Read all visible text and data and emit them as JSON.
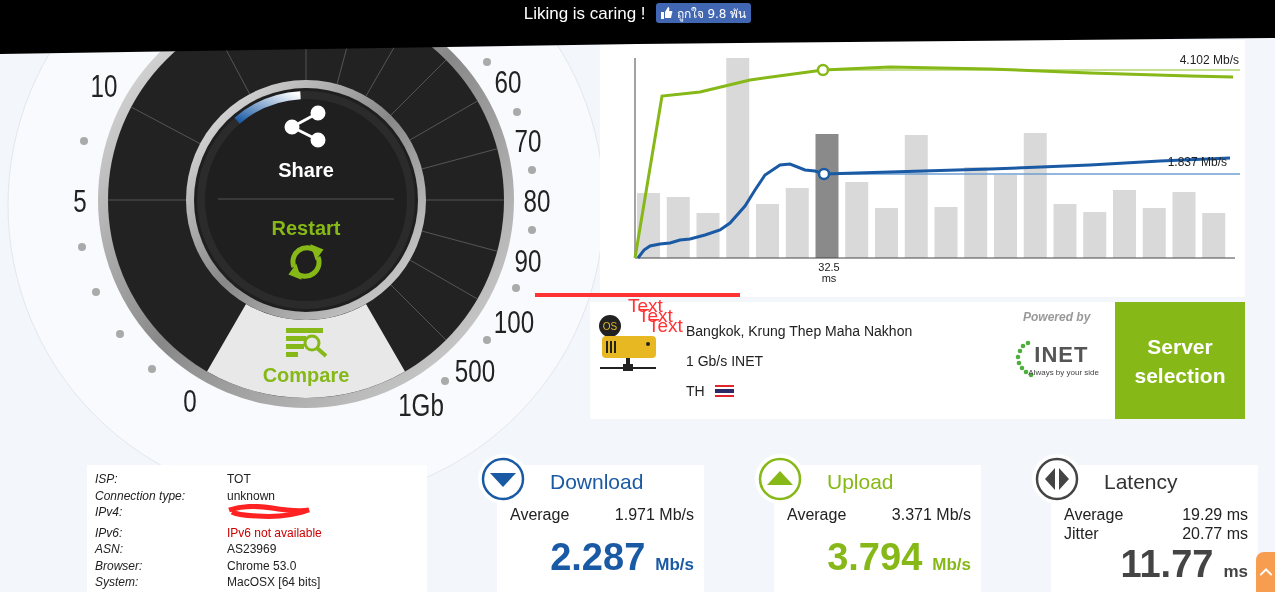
{
  "banner": {
    "text": "Liking is caring !",
    "like_button": "ถูกใจ 9.8 พัน"
  },
  "gauge": {
    "scale_labels": [
      "0",
      "5",
      "10",
      "60",
      "70",
      "80",
      "90",
      "100",
      "500",
      "1Gb"
    ],
    "share": "Share",
    "restart": "Restart",
    "compare": "Compare"
  },
  "chart": {
    "upload_label": "4.102 Mb/s",
    "download_label": "1.837 Mb/s",
    "marker_value": "32.5",
    "marker_unit": "ms"
  },
  "markup": {
    "texts": [
      "Text",
      "Text",
      "Text"
    ]
  },
  "server": {
    "badge": "OS",
    "location": "Bangkok, Krung Thep Maha Nakhon",
    "provider": "1 Gb/s INET",
    "country": "TH",
    "powered_by": "Powered by",
    "logo_text": "INET",
    "logo_tagline": "Always by your side",
    "button": "Server selection"
  },
  "connection_info": [
    {
      "label": "ISP:",
      "value": "TOT",
      "kind": "normal"
    },
    {
      "label": "Connection type:",
      "value": "unknown",
      "kind": "normal"
    },
    {
      "label": "IPv4:",
      "kind": "redacted"
    },
    {
      "label": "IPv6:",
      "value": "IPv6 not available",
      "kind": "error"
    },
    {
      "label": "ASN:",
      "value": "AS23969",
      "kind": "normal"
    },
    {
      "label": "Browser:",
      "value": "Chrome 53.0",
      "kind": "normal"
    },
    {
      "label": "System:",
      "value": "MacOSX [64 bits]",
      "kind": "normal"
    }
  ],
  "results": [
    {
      "kind": "download",
      "title": "Download",
      "rows": [
        {
          "label": "Average",
          "value": "1.971 Mb/s"
        }
      ],
      "value": "2.287",
      "unit": "Mb/s"
    },
    {
      "kind": "upload",
      "title": "Upload",
      "rows": [
        {
          "label": "Average",
          "value": "3.371 Mb/s"
        }
      ],
      "value": "3.794",
      "unit": "Mb/s"
    },
    {
      "kind": "latency",
      "title": "Latency",
      "rows": [
        {
          "label": "Average",
          "value": "19.29 ms"
        },
        {
          "label": "Jitter",
          "value": "20.77 ms"
        }
      ],
      "value": "11.77",
      "unit": "ms"
    }
  ]
}
